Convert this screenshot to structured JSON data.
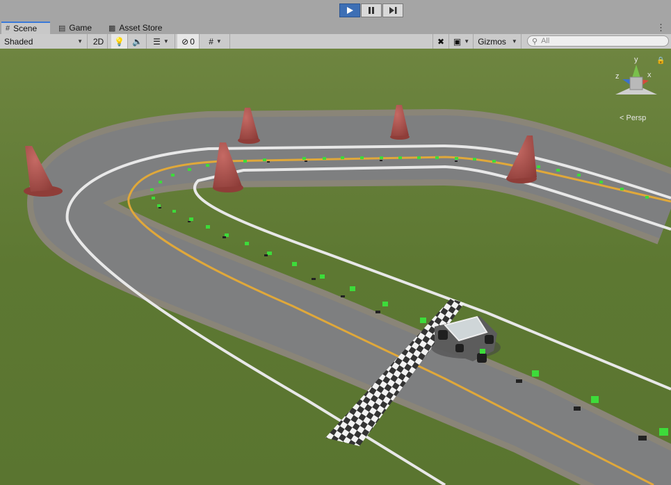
{
  "toolbar_top": {
    "play_icon": "play-icon",
    "pause_icon": "pause-icon",
    "step_icon": "step-icon"
  },
  "tabs": [
    {
      "label": "Scene",
      "icon": "grid-icon"
    },
    {
      "label": "Game",
      "icon": "gamepad-icon"
    },
    {
      "label": "Asset Store",
      "icon": "bag-icon"
    }
  ],
  "scene_toolbar": {
    "shading_mode": "Shaded",
    "two_d_label": "2D",
    "hidden_count": "0",
    "gizmos_label": "Gizmos",
    "search_placeholder": "All"
  },
  "gizmo": {
    "y_label": "y",
    "x_label": "x",
    "z_label": "z",
    "projection_label": "< Persp"
  },
  "colors": {
    "accent": "#3d6fb5",
    "grass": "#5f7a34",
    "track": "#7e7f80",
    "cone": "#a14a45"
  }
}
